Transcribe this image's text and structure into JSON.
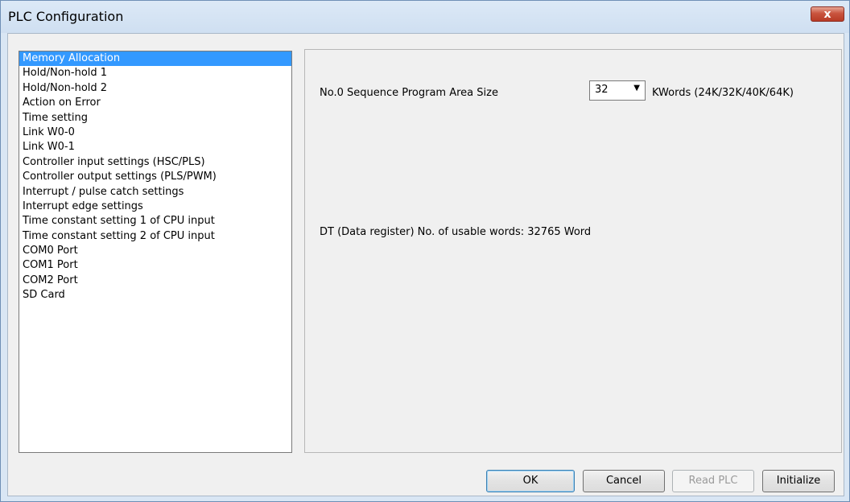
{
  "window": {
    "title": "PLC Configuration",
    "close_label": "x"
  },
  "sidebar": {
    "items": [
      {
        "label": "Memory Allocation",
        "selected": true
      },
      {
        "label": "Hold/Non-hold 1"
      },
      {
        "label": "Hold/Non-hold 2"
      },
      {
        "label": "Action on Error"
      },
      {
        "label": "Time setting"
      },
      {
        "label": "Link W0-0"
      },
      {
        "label": "Link W0-1"
      },
      {
        "label": "Controller input settings (HSC/PLS)"
      },
      {
        "label": "Controller output settings (PLS/PWM)"
      },
      {
        "label": "Interrupt / pulse catch settings"
      },
      {
        "label": "Interrupt edge settings"
      },
      {
        "label": "Time constant setting 1 of CPU input"
      },
      {
        "label": "Time constant setting 2 of CPU input"
      },
      {
        "label": "COM0 Port"
      },
      {
        "label": "COM1 Port"
      },
      {
        "label": "COM2 Port"
      },
      {
        "label": "SD Card"
      }
    ]
  },
  "main": {
    "area_size_label": "No.0 Sequence Program Area Size",
    "area_size_value": "32",
    "unit_label": "KWords  (24K/32K/40K/64K)",
    "dt_label": "DT (Data register) No. of usable words:  32765 Word"
  },
  "buttons": {
    "ok": "OK",
    "cancel": "Cancel",
    "read_plc": "Read PLC",
    "initialize": "Initialize"
  }
}
